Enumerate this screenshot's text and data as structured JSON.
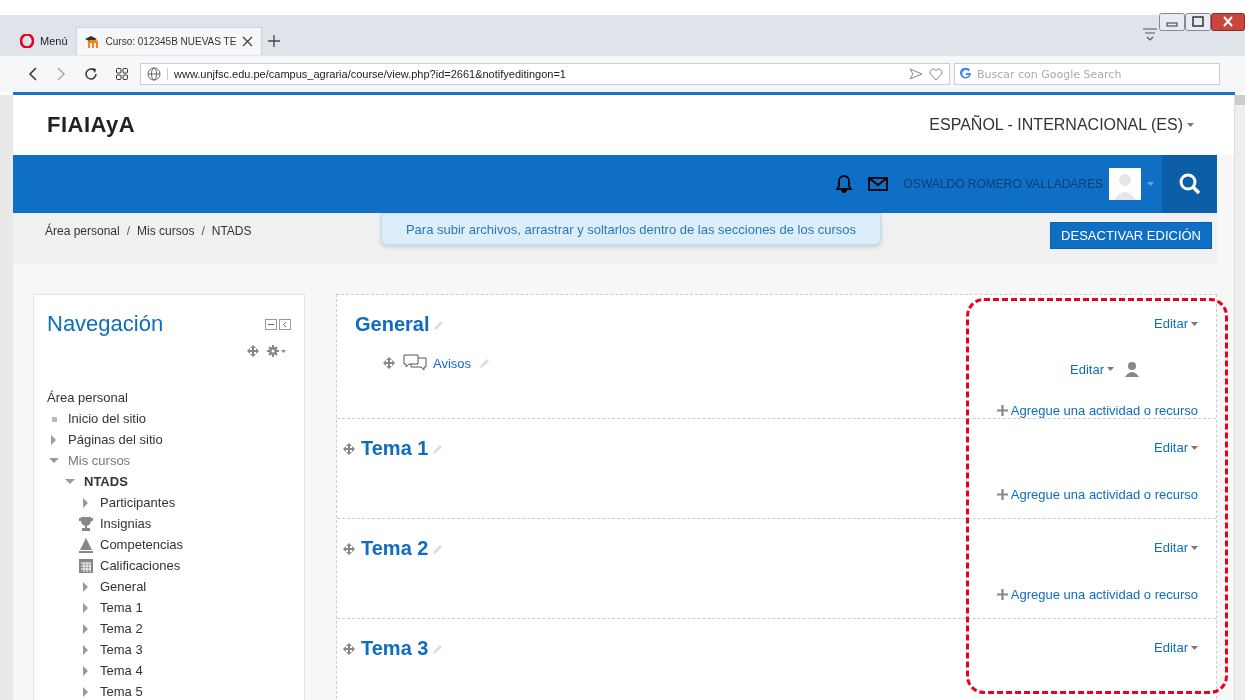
{
  "browser": {
    "tabs": [
      {
        "kind": "menu",
        "label": "Menú",
        "selected": false
      },
      {
        "kind": "page",
        "label": "Curso: 012345B NUEVAS TE",
        "selected": true
      }
    ],
    "url": "www.unjfsc.edu.pe/campus_agraria/course/view.php?id=2661&notifyeditingon=1",
    "search_placeholder": "Buscar con Google Search"
  },
  "header": {
    "logo": "FIAIAyA",
    "language": "ESPAÑOL - INTERNACIONAL (ES)"
  },
  "navbar": {
    "user_name": "OSWALDO ROMERO VALLADARES"
  },
  "breadcrumb": [
    {
      "label": "Área personal"
    },
    {
      "separator": "/",
      "label": "Mis cursos"
    },
    {
      "separator": "/",
      "label": "NTADS"
    }
  ],
  "notice": "Para subir archivos, arrastrar y soltarlos dentro de las secciones de los cursos",
  "edit_button": "DESACTIVAR EDICIÓN",
  "navigation": {
    "title": "Navegación",
    "tree": [
      {
        "kind": "root",
        "label": "Área personal",
        "children": [
          {
            "kind": "bullet",
            "label": "Inicio del sitio"
          },
          {
            "kind": "node",
            "label": "Páginas del sitio",
            "expanded": false
          },
          {
            "kind": "node",
            "label": "Mis cursos",
            "expanded": true,
            "children": [
              {
                "kind": "node",
                "label": "NTADS",
                "expanded": true,
                "bold": true,
                "children": [
                  {
                    "kind": "node",
                    "label": "Participantes",
                    "expanded": false
                  },
                  {
                    "kind": "trophy",
                    "label": "Insignias"
                  },
                  {
                    "kind": "competency",
                    "label": "Competencias"
                  },
                  {
                    "kind": "grades",
                    "label": "Calificaciones"
                  },
                  {
                    "kind": "node",
                    "label": "General",
                    "expanded": false
                  },
                  {
                    "kind": "node",
                    "label": "Tema 1",
                    "expanded": false
                  },
                  {
                    "kind": "node",
                    "label": "Tema 2",
                    "expanded": false
                  },
                  {
                    "kind": "node",
                    "label": "Tema 3",
                    "expanded": false
                  },
                  {
                    "kind": "node",
                    "label": "Tema 4",
                    "expanded": false
                  },
                  {
                    "kind": "node",
                    "label": "Tema 5",
                    "expanded": false
                  }
                ]
              }
            ]
          }
        ]
      }
    ]
  },
  "sections": [
    {
      "title": "General",
      "movable": false,
      "edit": "Editar",
      "activities": [
        {
          "name": "Avisos",
          "edit": "Editar"
        }
      ],
      "add": "Agregue una actividad o recurso"
    },
    {
      "title": "Tema 1",
      "movable": true,
      "edit": "Editar",
      "add": "Agregue una actividad o recurso"
    },
    {
      "title": "Tema 2",
      "movable": true,
      "edit": "Editar",
      "add": "Agregue una actividad o recurso"
    },
    {
      "title": "Tema 3",
      "movable": true,
      "edit": "Editar"
    }
  ]
}
